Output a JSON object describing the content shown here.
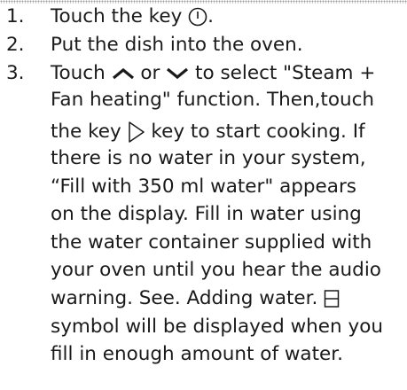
{
  "steps": [
    {
      "number": "1.",
      "parts": [
        "Touch the key ",
        "."
      ],
      "icon": "power-icon"
    },
    {
      "number": "2.",
      "text": "Put the dish into the oven."
    },
    {
      "number": "3.",
      "lines": {
        "l1_a": "Touch ",
        "l1_b": " or ",
        "l1_c": " to select \"Steam +",
        "l2": "Fan heating\" function. Then,touch",
        "l3_a": "the key ",
        "l3_b": " key to start cooking. If",
        "l4": "there is no water in your system,",
        "l5": "“Fill with 350 ml water\" appears",
        "l6": "on the display. Fill in water using",
        "l7": "the water container supplied with",
        "l8": "your oven until you hear the audio",
        "l9_a": "warning. See. Adding water. ",
        "l10": "symbol will be displayed when you",
        "l11": "fill in enough amount of water."
      },
      "icons": [
        "chevron-up-icon",
        "chevron-down-icon",
        "play-icon",
        "water-tank-icon"
      ]
    }
  ]
}
